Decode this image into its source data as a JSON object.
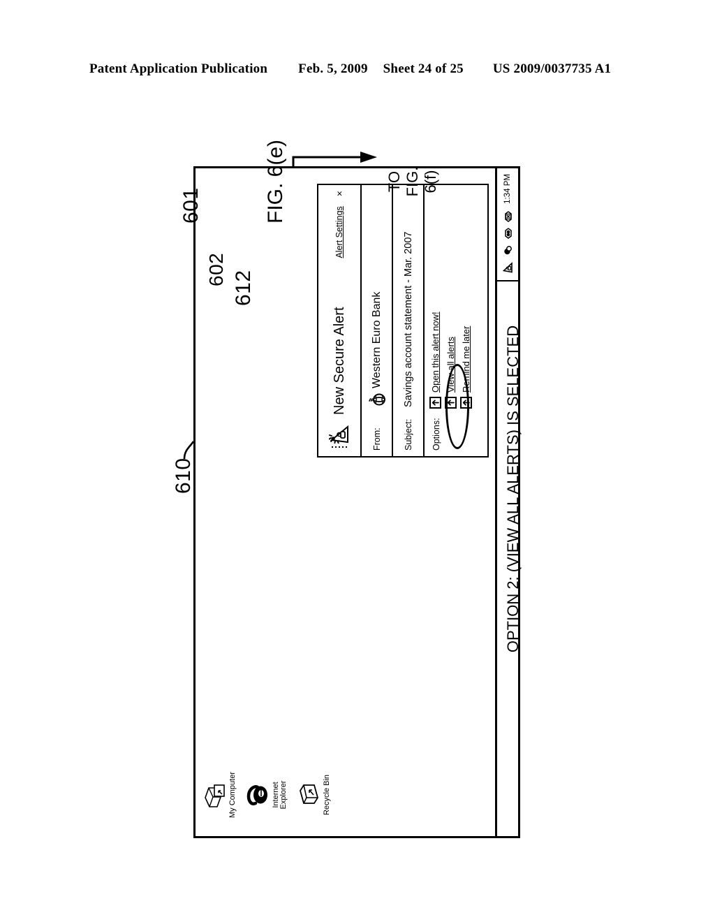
{
  "header": {
    "publication": "Patent Application Publication",
    "date": "Feb. 5, 2009",
    "sheet": "Sheet 24 of 25",
    "number": "US 2009/0037735 A1"
  },
  "figure": {
    "label": "FIG. 6(e)",
    "option_caption": "OPTION 2: (VIEW ALL ALERTS) IS SELECTED",
    "to_caption": "TO\nFIG. 6(f)",
    "reference_numerals": {
      "screen": "601",
      "tray_alert_icon": "602",
      "alert_popup": "610",
      "selected_option_callout": "612"
    }
  },
  "desktop": {
    "icons": [
      {
        "label": "My Computer",
        "icon": "my-computer-icon"
      },
      {
        "label": "Internet\nExplorer",
        "icon": "internet-explorer-icon"
      },
      {
        "label": "Recycle Bin",
        "icon": "recycle-bin-icon"
      }
    ],
    "taskbar": {
      "clock": "1:34 PM",
      "tray_icons": [
        "secure-alert-triangle-icon",
        "messaging-icon",
        "network-icon",
        "close-box-icon"
      ]
    }
  },
  "alert_popup": {
    "title": "New Secure Alert",
    "title_icon": "secure-alert-triangle-icon",
    "settings_link": "Alert Settings",
    "close_label": "×",
    "fields": [
      {
        "key": "From:",
        "value": "Western Euro Bank",
        "icon": "globe-icon"
      },
      {
        "key": "Subject:",
        "value": "Savings account statement - Mar. 2007",
        "icon": ""
      }
    ],
    "options_key": "Options:",
    "options": [
      {
        "label": "Open this alert now!",
        "icon": "arrow-up-icon",
        "selected": false
      },
      {
        "label": "View all alerts",
        "icon": "arrow-up-icon",
        "selected": true
      },
      {
        "label": "Remind me later",
        "icon": "arrow-up-icon",
        "selected": false
      }
    ]
  }
}
